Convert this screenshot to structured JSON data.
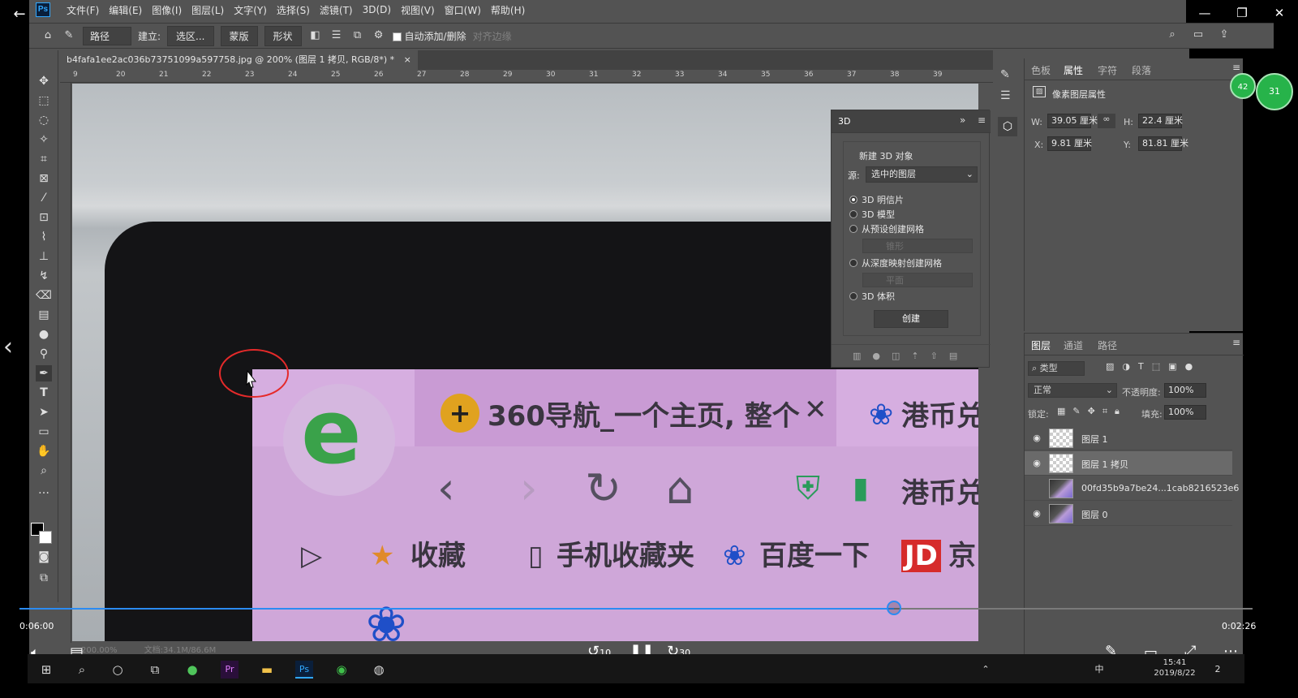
{
  "player": {
    "back_label": "←",
    "time_elapsed": "0:06:00",
    "time_remaining": "0:02:26",
    "progress_fraction": 0.709,
    "rewind_label": "10",
    "forward_label": "30",
    "window_controls": [
      "—",
      "❐",
      "✕"
    ]
  },
  "photoshop": {
    "logo_text": "Ps",
    "menu": [
      "文件(F)",
      "编辑(E)",
      "图像(I)",
      "图层(L)",
      "文字(Y)",
      "选择(S)",
      "滤镜(T)",
      "3D(D)",
      "视图(V)",
      "窗口(W)",
      "帮助(H)"
    ],
    "options": {
      "mode_value": "路径",
      "build_label": "建立:",
      "selection_button": "选区...",
      "mask_button": "蒙版",
      "shape_button": "形状",
      "auto_add_delete_label": "自动添加/删除",
      "align_edges_label": "对齐边缘"
    },
    "document_tab": "b4fafa1ee2ac036b73751099a597758.jpg @ 200% (图层 1 拷贝, RGB/8*) *",
    "ruler_ticks": [
      "9",
      "20",
      "21",
      "22",
      "23",
      "24",
      "25",
      "26",
      "27",
      "28",
      "29",
      "30",
      "31",
      "32",
      "33",
      "34",
      "35",
      "36",
      "37",
      "38",
      "39"
    ],
    "status": {
      "zoom": "200.00%",
      "doc_size": "文档:34.1M/86.6M"
    }
  },
  "canvas_photo": {
    "tab1_title": "360导航_一个主页, 整个",
    "tab1_close": "✕",
    "tab2_title": "港币兑",
    "nav_address_text": "港币兑",
    "bookmark_favorites": "收藏",
    "bookmark_mobile": "手机收藏夹",
    "bookmark_baidu": "百度一下",
    "bookmark_jd_badge": "JD",
    "bookmark_jd_text": "京"
  },
  "panel_3d": {
    "title": "3D",
    "section_title": "新建 3D 对象",
    "source_label": "源:",
    "source_value": "选中的图层",
    "options": [
      {
        "label": "3D 明信片",
        "selected": true
      },
      {
        "label": "3D 模型",
        "selected": false
      },
      {
        "label": "从预设创建网格",
        "selected": false
      },
      {
        "label": "从深度映射创建网格",
        "selected": false
      },
      {
        "label": "3D 体积",
        "selected": false
      }
    ],
    "preset_select": "锥形",
    "depth_select": "平面",
    "create_button": "创建"
  },
  "properties": {
    "tabs": [
      "色板",
      "属性",
      "字符",
      "段落"
    ],
    "active_tab": "属性",
    "header": "像素图层属性",
    "w_label": "W:",
    "w_value": "39.05 厘米",
    "h_label": "H:",
    "h_value": "22.4 厘米",
    "x_label": "X:",
    "x_value": "9.81 厘米",
    "y_label": "Y:",
    "y_value": "81.81 厘米"
  },
  "layers": {
    "tabs": [
      "图层",
      "通道",
      "路径"
    ],
    "active_tab": "图层",
    "filter_label": "类型",
    "blend_mode": "正常",
    "opacity_label": "不透明度:",
    "opacity_value": "100%",
    "lock_label": "锁定:",
    "fill_label": "填充:",
    "fill_value": "100%",
    "items": [
      {
        "name": "图层 1",
        "visible": true,
        "selected": false,
        "thumb": "transparent"
      },
      {
        "name": "图层 1 拷贝",
        "visible": true,
        "selected": true,
        "thumb": "transparent"
      },
      {
        "name": "00fd35b9a7be24...1cab8216523e6",
        "visible": false,
        "selected": false,
        "thumb": "photo"
      },
      {
        "name": "图层 0",
        "visible": true,
        "selected": false,
        "thumb": "photo"
      }
    ]
  },
  "badges": {
    "left": "42",
    "right": "31"
  },
  "taskbar": {
    "time": "15:41",
    "date": "2019/8/22",
    "ime": "中",
    "notification_count": "2"
  },
  "colors": {
    "ps_panel": "#535353",
    "progress_blue": "#2b8bf2",
    "annotation_red": "#e52a2a",
    "screen_purple": "#cfa7d9"
  }
}
